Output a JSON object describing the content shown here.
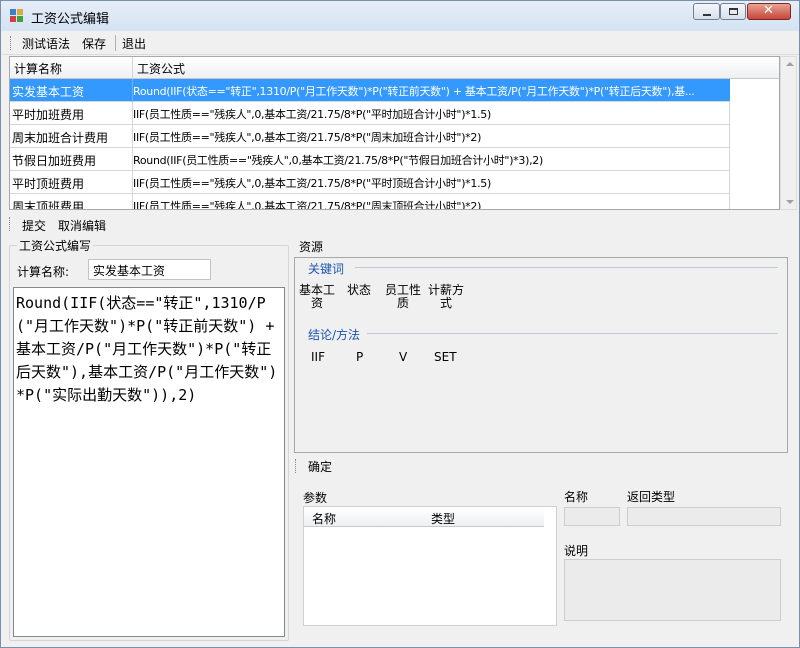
{
  "window": {
    "title": "工资公式编辑"
  },
  "toolbar": {
    "test_syntax": "测试语法",
    "save": "保存",
    "exit": "退出"
  },
  "grid": {
    "headers": [
      "计算名称",
      "工资公式"
    ],
    "rows": [
      {
        "name": "实发基本工资",
        "formula": "Round(IIF(状态==\"转正\",1310/P(\"月工作天数\")*P(\"转正前天数\") + 基本工资/P(\"月工作天数\")*P(\"转正后天数\"),基..."
      },
      {
        "name": "平时加班费用",
        "formula": "IIF(员工性质==\"残疾人\",0,基本工资/21.75/8*P(\"平时加班合计小时\")*1.5)"
      },
      {
        "name": "周末加班合计费用",
        "formula": "IIF(员工性质==\"残疾人\",0,基本工资/21.75/8*P(\"周末加班合计小时\")*2)"
      },
      {
        "name": "节假日加班费用",
        "formula": "Round(IIF(员工性质==\"残疾人\",0,基本工资/21.75/8*P(\"节假日加班合计小时\")*3),2)"
      },
      {
        "name": "平时顶班费用",
        "formula": "IIF(员工性质==\"残疾人\",0,基本工资/21.75/8*P(\"平时顶班合计小时\")*1.5)"
      },
      {
        "name": "周末顶班费用",
        "formula": "IIF(员工性质==\"残疾人\",0,基本工资/21.75/8*P(\"周末顶班合计小时\")*2)"
      }
    ]
  },
  "edit_toolbar": {
    "submit": "提交",
    "cancel_edit": "取消编辑"
  },
  "editor_group": {
    "title": "工资公式编写",
    "name_label": "计算名称:",
    "name_value": "实发基本工资",
    "formula": "Round(IIF(状态==\"转正\",1310/P(\"月工作天数\")*P(\"转正前天数\") + 基本工资/P(\"月工作天数\")*P(\"转正后天数\"),基本工资/P(\"月工作天数\")*P(\"实际出勤天数\")),2)"
  },
  "resources": {
    "title": "资源",
    "keywords_title": "关键词",
    "keywords": [
      "基本工资",
      "状态",
      "员工性质",
      "计薪方式"
    ],
    "functions_title": "结论/方法",
    "functions": [
      "IIF",
      "P",
      "V",
      "SET"
    ]
  },
  "confirm_toolbar": {
    "confirm": "确定"
  },
  "details": {
    "params_label": "参数",
    "params_headers": [
      "名称",
      "类型"
    ],
    "name_label": "名称",
    "return_type_label": "返回类型",
    "description_label": "说明"
  },
  "colors": {
    "selection": "#3399ff",
    "section_title": "#1a55b0"
  }
}
